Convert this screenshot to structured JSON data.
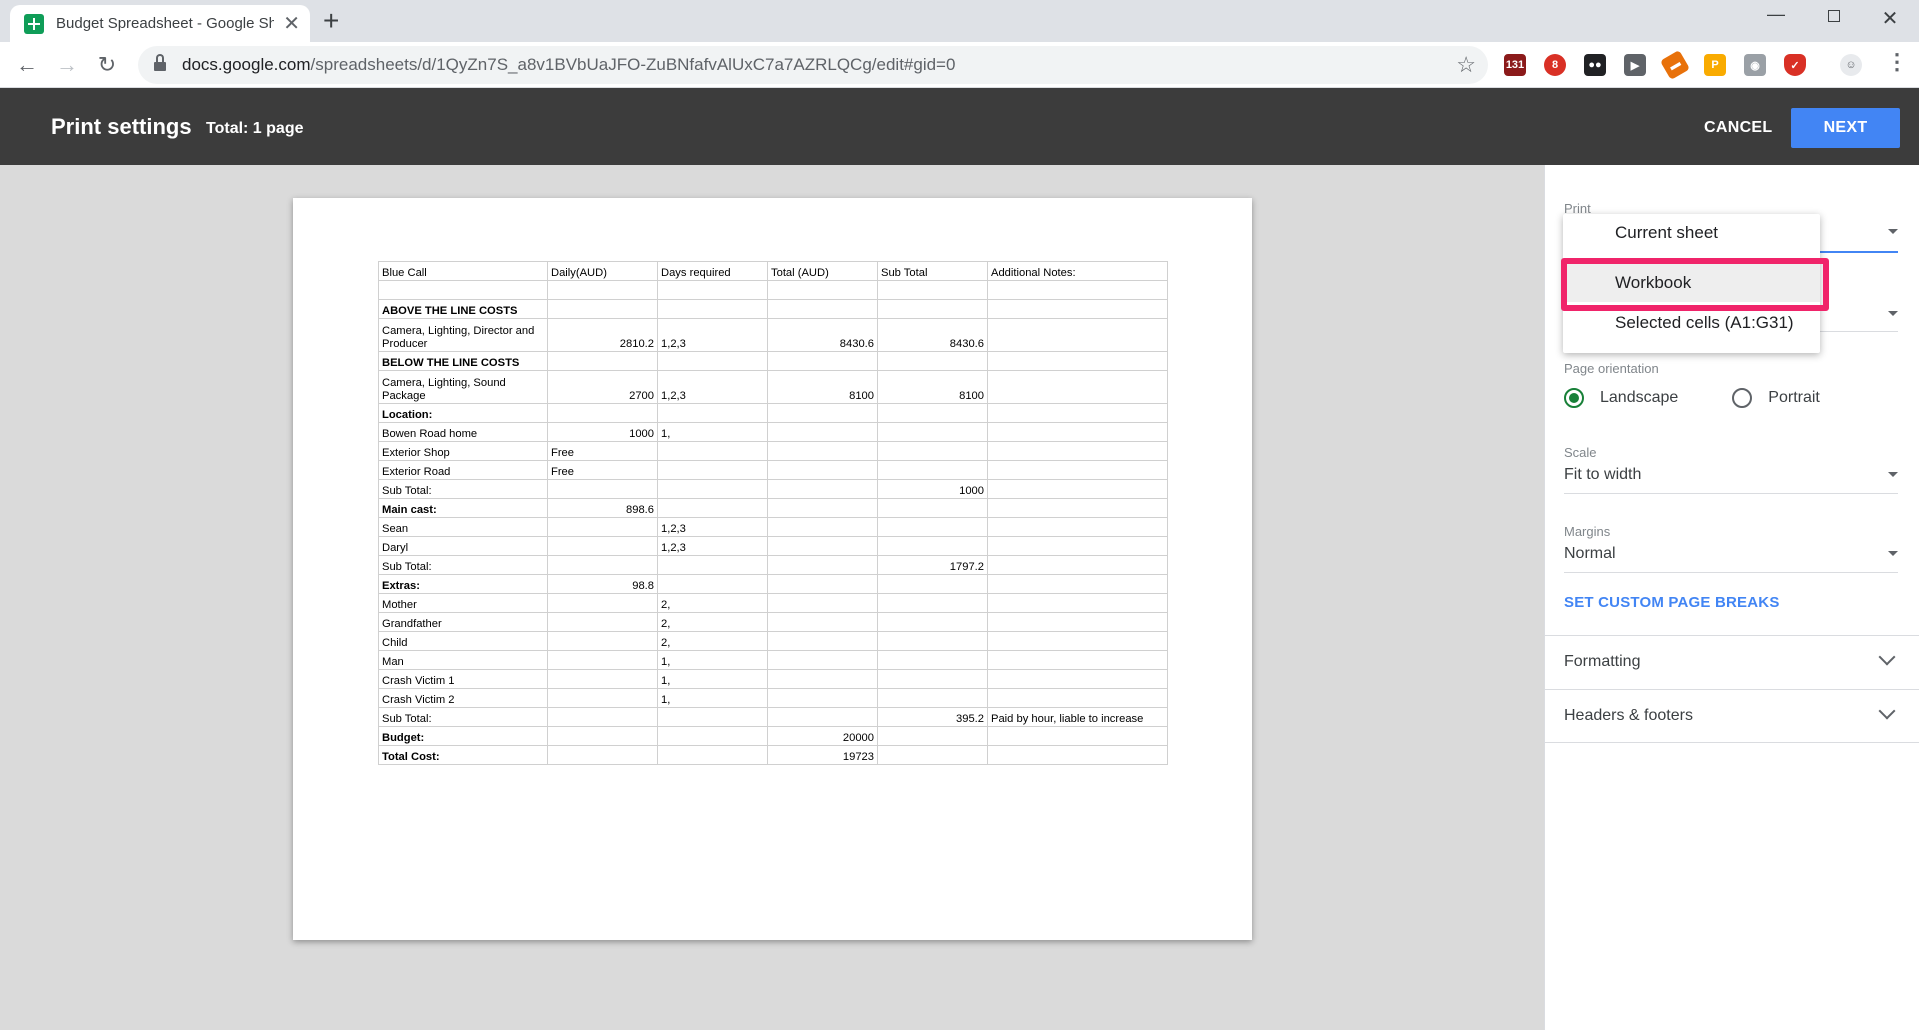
{
  "browser": {
    "tab_title": "Budget Spreadsheet - Google Sheets",
    "url_host": "docs.google.com",
    "url_path": "/spreadsheets/d/1QyZn7S_a8v1BVbUaJFO-ZuBNfafvAlUxC7a7AZRLQCg/edit#gid=0",
    "extension_badge": "131"
  },
  "header": {
    "title": "Print settings",
    "total": "Total: 1 page",
    "cancel_label": "CANCEL",
    "next_label": "NEXT"
  },
  "sheet": {
    "rows": [
      {
        "bold": false,
        "tall": false,
        "cells": [
          "Blue Call",
          "Daily(AUD)",
          "Days required",
          "Total (AUD)",
          "Sub Total",
          "Additional Notes:"
        ]
      },
      {
        "bold": false,
        "tall": false,
        "cells": [
          "",
          "",
          "",
          "",
          "",
          ""
        ]
      },
      {
        "bold": true,
        "tall": false,
        "cells": [
          "ABOVE THE LINE COSTS",
          "",
          "",
          "",
          "",
          ""
        ]
      },
      {
        "bold": false,
        "tall": true,
        "cells": [
          "Camera, Lighting, Director and Producer",
          "2810.2",
          "1,2,3",
          "8430.6",
          "8430.6",
          ""
        ]
      },
      {
        "bold": true,
        "tall": false,
        "cells": [
          "BELOW THE LINE COSTS",
          "",
          "",
          "",
          "",
          ""
        ]
      },
      {
        "bold": false,
        "tall": true,
        "cells": [
          "Camera, Lighting, Sound Package",
          "2700",
          "1,2,3",
          "8100",
          "8100",
          ""
        ]
      },
      {
        "bold": true,
        "tall": false,
        "cells": [
          "Location:",
          "",
          "",
          "",
          "",
          ""
        ]
      },
      {
        "bold": false,
        "tall": false,
        "cells": [
          "Bowen Road home",
          "1000",
          "1,",
          "",
          "",
          ""
        ]
      },
      {
        "bold": false,
        "tall": false,
        "cells": [
          "Exterior Shop",
          "Free",
          "",
          "",
          "",
          ""
        ]
      },
      {
        "bold": false,
        "tall": false,
        "cells": [
          "Exterior Road",
          "Free",
          "",
          "",
          "",
          ""
        ]
      },
      {
        "bold": false,
        "tall": false,
        "cells": [
          "Sub Total:",
          "",
          "",
          "",
          "1000",
          ""
        ]
      },
      {
        "bold": true,
        "tall": false,
        "cells": [
          "Main cast:",
          "898.6",
          "",
          "",
          "",
          ""
        ]
      },
      {
        "bold": false,
        "tall": false,
        "cells": [
          "Sean",
          "",
          "1,2,3",
          "",
          "",
          ""
        ]
      },
      {
        "bold": false,
        "tall": false,
        "cells": [
          "Daryl",
          "",
          "1,2,3",
          "",
          "",
          ""
        ]
      },
      {
        "bold": false,
        "tall": false,
        "cells": [
          "Sub Total:",
          "",
          "",
          "",
          "1797.2",
          ""
        ]
      },
      {
        "bold": true,
        "tall": false,
        "cells": [
          "Extras:",
          "98.8",
          "",
          "",
          "",
          ""
        ]
      },
      {
        "bold": false,
        "tall": false,
        "cells": [
          "Mother",
          "",
          "2,",
          "",
          "",
          ""
        ]
      },
      {
        "bold": false,
        "tall": false,
        "cells": [
          "Grandfather",
          "",
          "2,",
          "",
          "",
          ""
        ]
      },
      {
        "bold": false,
        "tall": false,
        "cells": [
          "Child",
          "",
          "2,",
          "",
          "",
          ""
        ]
      },
      {
        "bold": false,
        "tall": false,
        "cells": [
          "Man",
          "",
          "1,",
          "",
          "",
          ""
        ]
      },
      {
        "bold": false,
        "tall": false,
        "cells": [
          "Crash Victim 1",
          "",
          "1,",
          "",
          "",
          ""
        ]
      },
      {
        "bold": false,
        "tall": false,
        "cells": [
          "Crash Victim 2",
          "",
          "1,",
          "",
          "",
          ""
        ]
      },
      {
        "bold": false,
        "tall": false,
        "cells": [
          "Sub Total:",
          "",
          "",
          "",
          "395.2",
          "Paid by hour, liable to increase"
        ]
      },
      {
        "bold": true,
        "tall": false,
        "cells": [
          "Budget:",
          "",
          "",
          "20000",
          "",
          ""
        ]
      },
      {
        "bold": true,
        "tall": false,
        "cells": [
          "Total Cost:",
          "",
          "",
          "19723",
          "",
          ""
        ]
      }
    ]
  },
  "panel": {
    "print_label": "Print",
    "page_orientation_label": "Page orientation",
    "landscape_label": "Landscape",
    "portrait_label": "Portrait",
    "orientation_selected": "Landscape",
    "scale_label": "Scale",
    "scale_value": "Fit to width",
    "margins_label": "Margins",
    "margins_value": "Normal",
    "custom_breaks_label": "SET CUSTOM PAGE BREAKS",
    "formatting_label": "Formatting",
    "headers_footers_label": "Headers & footers"
  },
  "dropdown": {
    "items": [
      "Current sheet",
      "Workbook",
      "Selected cells (A1:G31)"
    ],
    "selected_index": 1
  },
  "colors": {
    "header_bg": "#3c3c3c",
    "accent_blue": "#4285f4",
    "radio_green": "#188038",
    "highlight": "#f0246a"
  }
}
